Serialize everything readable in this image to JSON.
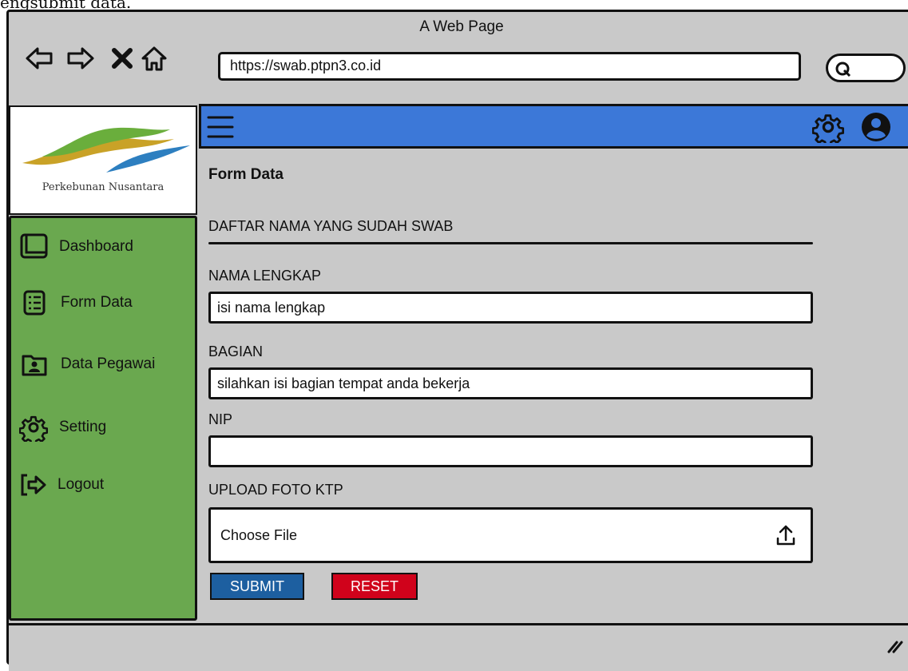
{
  "caption": "engsubmit data.",
  "window": {
    "title": "A Web Page"
  },
  "browser": {
    "url": "https://swab.ptpn3.co.id",
    "icons": [
      "back-arrow-icon",
      "forward-arrow-icon",
      "close-x-icon",
      "home-icon",
      "search-icon"
    ]
  },
  "logo": {
    "text": "Perkebunan Nusantara"
  },
  "sidebar": {
    "items": [
      {
        "label": "Dashboard",
        "icon": "dashboard-window-icon"
      },
      {
        "label": "Form Data",
        "icon": "list-document-icon"
      },
      {
        "label": "Data Pegawai",
        "icon": "user-folder-icon"
      },
      {
        "label": "Setting",
        "icon": "gear-icon"
      },
      {
        "label": "Logout",
        "icon": "logout-icon"
      }
    ]
  },
  "topbar": {
    "color": "#3c78d8",
    "icons": [
      "hamburger-icon",
      "gear-icon",
      "user-avatar-icon"
    ]
  },
  "form": {
    "page_title": "Form Data",
    "section_title": "DAFTAR NAMA YANG SUDAH SWAB",
    "nama_label": "NAMA LENGKAP",
    "nama_value": "isi nama lengkap",
    "bagian_label": "BAGIAN",
    "bagian_value": "silahkan isi bagian tempat anda bekerja",
    "nip_label": "NIP",
    "nip_value": "",
    "upload_label": "UPLOAD FOTO KTP",
    "file_label": "Choose File",
    "submit_label": "SUBMIT",
    "reset_label": "RESET"
  },
  "colors": {
    "sidebar": "#6aa84f",
    "submit": "#1d5fa0",
    "reset": "#d0021b",
    "chrome": "#c9c9c9"
  }
}
